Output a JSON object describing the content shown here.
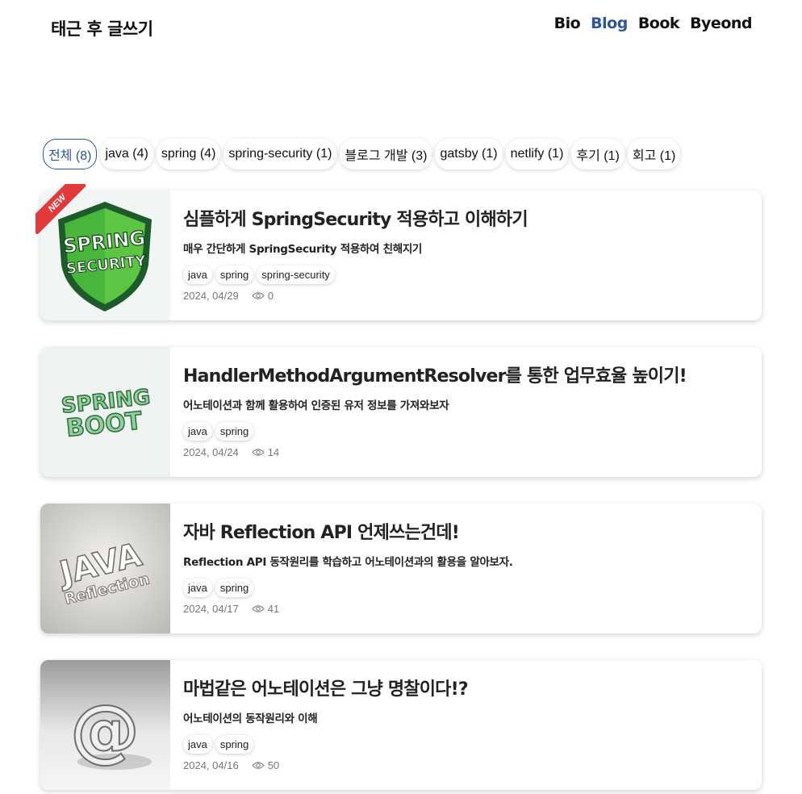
{
  "header": {
    "site_title": "태근 후 글쓰기",
    "nav": [
      {
        "label": "Bio",
        "active": false
      },
      {
        "label": "Blog",
        "active": true
      },
      {
        "label": "Book",
        "active": false
      },
      {
        "label": "Byeond",
        "active": false
      }
    ]
  },
  "filters": [
    {
      "label": "전체 (8)",
      "active": true
    },
    {
      "label": "java (4)"
    },
    {
      "label": "spring (4)"
    },
    {
      "label": "spring-security (1)"
    },
    {
      "label": "블로그 개발 (3)"
    },
    {
      "label": "gatsby (1)"
    },
    {
      "label": "netlify (1)"
    },
    {
      "label": "후기 (1)"
    },
    {
      "label": "회고 (1)"
    }
  ],
  "posts": [
    {
      "title": "심플하게 SpringSecurity 적용하고 이해하기",
      "description": "매우 간단하게 SpringSecurity 적용하여 친해지기",
      "tags": [
        "java",
        "spring",
        "spring-security"
      ],
      "date": "2024, 04/29",
      "views": "0",
      "badge": "NEW",
      "thumb_text": [
        "SPRING",
        "SECURITY"
      ]
    },
    {
      "title": "HandlerMethodArgumentResolver를 통한 업무효율 높이기!",
      "description": "어노테이션과 함께 활용하여 인증된 유저 정보를 가져와보자",
      "tags": [
        "java",
        "spring"
      ],
      "date": "2024, 04/24",
      "views": "14",
      "thumb_text": [
        "SPRING",
        "BOOT"
      ]
    },
    {
      "title": "자바 Reflection API 언제쓰는건데!",
      "description": "Reflection API 동작원리를 학습하고 어노테이션과의 활용을 알아보자.",
      "tags": [
        "java",
        "spring"
      ],
      "date": "2024, 04/17",
      "views": "41",
      "thumb_text": [
        "JAVA",
        "Reflection"
      ]
    },
    {
      "title": "마법같은 어노테이션은 그냥 명찰이다!?",
      "description": "어노테이션의 동작원리와 이해",
      "tags": [
        "java",
        "spring"
      ],
      "date": "2024, 04/16",
      "views": "50",
      "thumb_text": [
        "@"
      ]
    }
  ],
  "colors": {
    "accent": "#2c5697",
    "ribbon": "#e23a3a",
    "meta_text": "#777777"
  }
}
